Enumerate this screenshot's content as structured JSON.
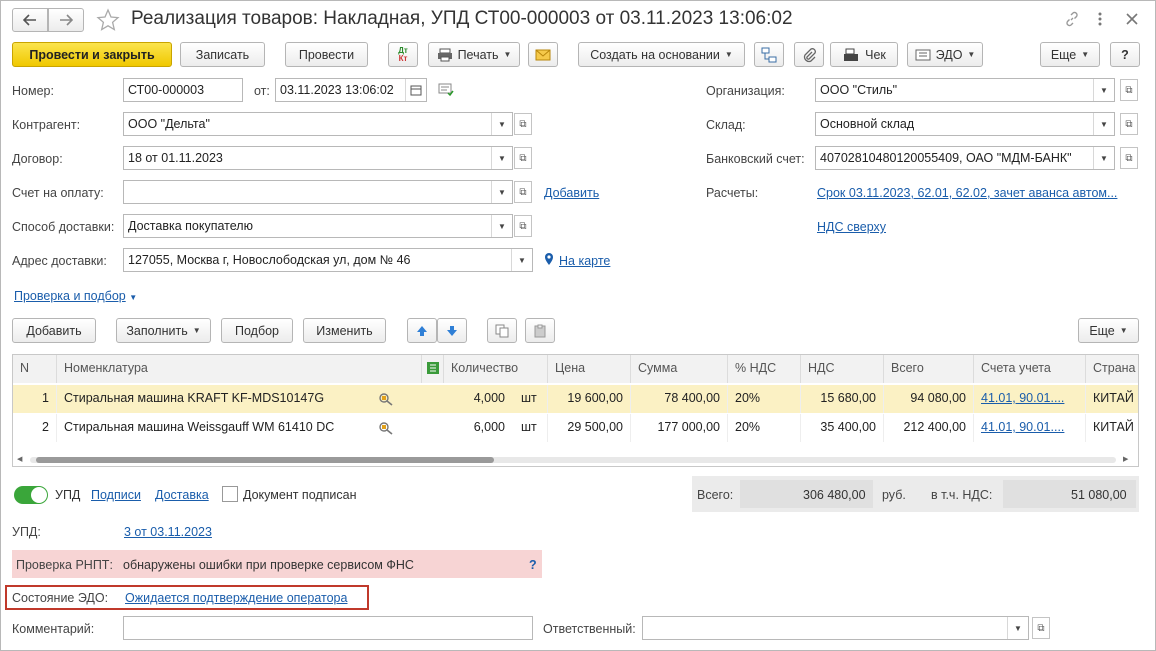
{
  "window": {
    "title": "Реализация товаров: Накладная, УПД СТ00-000003 от 03.11.2023 13:06:02"
  },
  "toolbar": {
    "post_close": "Провести и закрыть",
    "write": "Записать",
    "post": "Провести",
    "dtkt": "Дт\nКт",
    "print": "Печать",
    "create_based": "Создать на основании",
    "check": "Чек",
    "edo": "ЭДО",
    "more": "Еще",
    "help": "?"
  },
  "form": {
    "number_label": "Номер:",
    "number_value": "СТ00-000003",
    "from_label": "от:",
    "date_value": "03.11.2023 13:06:02",
    "org_label": "Организация:",
    "org_value": "ООО \"Стиль\"",
    "counterparty_label": "Контрагент:",
    "counterparty_value": "ООО \"Дельта\"",
    "warehouse_label": "Склад:",
    "warehouse_value": "Основной склад",
    "contract_label": "Договор:",
    "contract_value": "18 от 01.11.2023",
    "bank_label": "Банковский счет:",
    "bank_value": "40702810480120055409, ОАО \"МДМ-БАНК\"",
    "invoice_label": "Счет на оплату:",
    "invoice_value": "",
    "add_link": "Добавить",
    "settlements_label": "Расчеты:",
    "settlements_link": "Срок 03.11.2023, 62.01, 62.02, зачет аванса автом...",
    "delivery_method_label": "Способ доставки:",
    "delivery_method_value": "Доставка покупателю",
    "vat_link": "НДС сверху",
    "address_label": "Адрес доставки:",
    "address_value": "127055, Москва г, Новослободская ул, дом № 46",
    "map_link": "На карте",
    "check_select_link": "Проверка и подбор"
  },
  "table_toolbar": {
    "add": "Добавить",
    "fill": "Заполнить",
    "select": "Подбор",
    "change": "Изменить",
    "more": "Еще"
  },
  "table": {
    "headers": [
      "N",
      "Номенклатура",
      "Количество",
      "Цена",
      "Сумма",
      "% НДС",
      "НДС",
      "Всего",
      "Счета учета",
      "Страна"
    ],
    "rows": [
      {
        "n": "1",
        "name": "Стиральная машина KRAFT KF-MDS10147G",
        "qty": "4,000",
        "unit": "шт",
        "price": "19 600,00",
        "sum": "78 400,00",
        "vat_rate": "20%",
        "vat": "15 680,00",
        "total": "94 080,00",
        "accounts": "41.01, 90.01....",
        "country": "КИТАЙ"
      },
      {
        "n": "2",
        "name": "Стиральная машина Weissgauff WM 61410 DC",
        "qty": "6,000",
        "unit": "шт",
        "price": "29 500,00",
        "sum": "177 000,00",
        "vat_rate": "20%",
        "vat": "35 400,00",
        "total": "212 400,00",
        "accounts": "41.01, 90.01....",
        "country": "КИТАЙ"
      }
    ]
  },
  "footer": {
    "upd_toggle_label": "УПД",
    "signatures_link": "Подписи",
    "delivery_link": "Доставка",
    "signed_label": "Документ подписан",
    "total_label": "Всего:",
    "total_value": "306 480,00",
    "currency": "руб.",
    "incl_vat_label": "в т.ч. НДС:",
    "vat_value": "51 080,00",
    "upd_label": "УПД:",
    "upd_link": "3 от 03.11.2023",
    "rnpt_label": "Проверка РНПТ:",
    "rnpt_text": "обнаружены ошибки при проверке сервисом ФНС",
    "rnpt_help": "?",
    "edo_state_label": "Состояние ЭДО:",
    "edo_state_link": "Ожидается подтверждение оператора",
    "comment_label": "Комментарий:",
    "comment_value": "",
    "responsible_label": "Ответственный:",
    "responsible_value": ""
  },
  "colors": {
    "primary_button": "#f5d423",
    "selected_row": "#fbf1c4",
    "error_banner": "#f7d4d4",
    "link": "#1a5dab",
    "toggle_on": "#3aa63a",
    "highlight_box": "#c0392b"
  }
}
